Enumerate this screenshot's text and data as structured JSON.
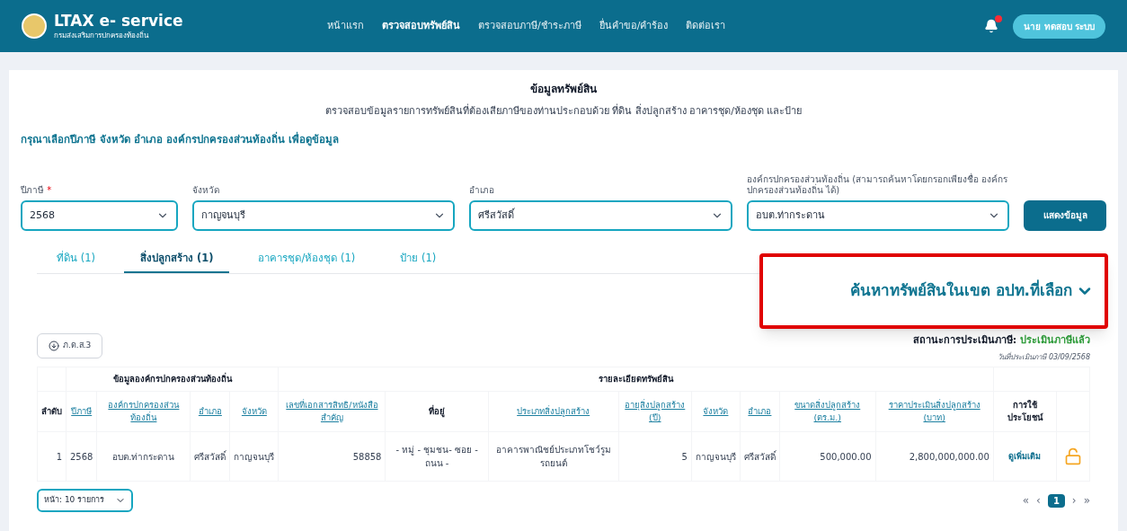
{
  "header": {
    "logo_title": "LTAX e- service",
    "logo_subtitle": "กรมส่งเสริมการปกครองท้องถิ่น",
    "nav": [
      {
        "label": "หน้าแรก",
        "selected": false
      },
      {
        "label": "ตรวจสอบทรัพย์สิน",
        "selected": true
      },
      {
        "label": "ตรวจสอบภาษี/ชำระภาษี",
        "selected": false
      },
      {
        "label": "ยื่นคำขอ/คำร้อง",
        "selected": false
      },
      {
        "label": "ติดต่อเรา",
        "selected": false
      }
    ],
    "notification_dot": true,
    "user_button": "นาย ทดสอบ ระบบ"
  },
  "page": {
    "title": "ข้อมูลทรัพย์สิน",
    "subtitle": "ตรวจสอบข้อมูลรายการทรัพย์สินที่ต้องเสียภาษีของท่านประกอบด้วย ที่ดิน สิ่งปลูกสร้าง อาคารชุด/ห้องชุด และป้าย",
    "prompt": "กรุณาเลือกปีภาษี จังหวัด อำเภอ องค์กรปกครองส่วนท้องถิ่น เพื่อดูข้อมูล"
  },
  "filters": [
    {
      "label": "ปีภาษี",
      "required": true,
      "value": "2568"
    },
    {
      "label": "จังหวัด",
      "required": false,
      "value": "กาญจนบุรี"
    },
    {
      "label": "อำเภอ",
      "required": false,
      "value": "ศรีสวัสดิ์"
    },
    {
      "label": "องค์กรปกครองส่วนท้องถิ่น (สามารถค้นหาโดยกรอกเพียงชื่อ องค์กรปกครองส่วนท้องถิ่น ได้)",
      "required": false,
      "value": "อบต.ท่ากระดาน"
    }
  ],
  "show_button": "แสดงข้อมูล",
  "tabs": [
    {
      "label": "ที่ดิน (1)",
      "selected": false
    },
    {
      "label": "สิ่งปลูกสร้าง (1)",
      "selected": true
    },
    {
      "label": "อาคารชุด/ห้องชุด (1)",
      "selected": false
    },
    {
      "label": "ป้าย (1)",
      "selected": false
    }
  ],
  "search_toggle": "ค้นหาทรัพย์สินในเขต อปท.ที่เลือก",
  "download_button": "ภ.ด.ส.3",
  "status": {
    "label": "สถานะการประเมินภาษี:",
    "value": "ประเมินภาษีแล้ว",
    "date": "วันที่ประเมินภาษี 03/09/2568"
  },
  "required_mark": "*",
  "table": {
    "group_headers": [
      {
        "label": "ข้อมูลองค์กรปกครองส่วนท้องถิ่น"
      },
      {
        "label": "รายละเอียดทรัพย์สิน"
      }
    ],
    "columns": [
      {
        "label": "ลำดับ",
        "sortable": false
      },
      {
        "label": "ปีภาษี",
        "sortable": true
      },
      {
        "label": "องค์กรปกครองส่วนท้องถิ่น",
        "sortable": true
      },
      {
        "label": "อำเภอ",
        "sortable": true
      },
      {
        "label": "จังหวัด",
        "sortable": true
      },
      {
        "label": "เลขที่เอกสารสิทธิ/หนังสือสำคัญ",
        "sortable": true
      },
      {
        "label": "ที่อยู่",
        "sortable": false
      },
      {
        "label": "ประเภทสิ่งปลูกสร้าง",
        "sortable": true
      },
      {
        "label": "อายุสิ่งปลูกสร้าง (ปี)",
        "sortable": true
      },
      {
        "label": "จังหวัด",
        "sortable": true
      },
      {
        "label": "อำเภอ",
        "sortable": true
      },
      {
        "label": "ขนาดสิ่งปลูกสร้าง (ตร.ม.)",
        "sortable": true
      },
      {
        "label": "ราคาประเมินสิ่งปลูกสร้าง (บาท)",
        "sortable": true
      },
      {
        "label": "การใช้ประโยชน์",
        "sortable": false
      }
    ],
    "rows": [
      {
        "cells": [
          "1",
          "2568",
          "อบต.ท่ากระดาน",
          "ศรีสวัสดิ์",
          "กาญจนบุรี",
          "58858",
          "- หมู่ - ชุมชน- ซอย - ถนน -",
          "อาคารพาณิชย์ประเภทโชว์รูมรถยนต์",
          "5",
          "กาญจนบุรี",
          "ศรีสวัสดิ์",
          "500,000.00",
          "2,800,000,000.00"
        ],
        "action": "ดูเพิ่มเติม"
      }
    ]
  },
  "page_size": "หน้า: 10 รายการ",
  "pagination": {
    "first": "«",
    "prev": "‹",
    "pages": [
      {
        "label": "1",
        "selected": true
      }
    ],
    "next": "›",
    "last": "»"
  }
}
